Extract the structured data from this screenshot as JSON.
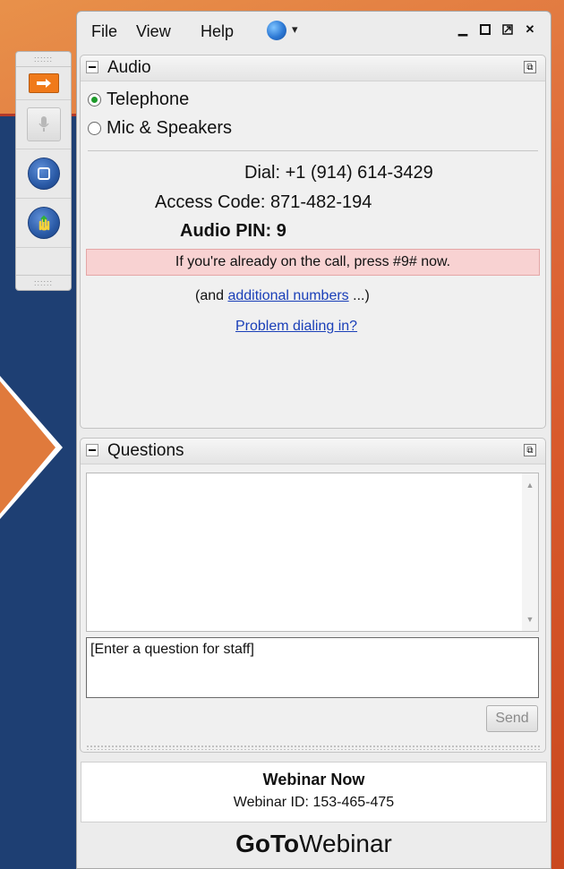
{
  "menu": {
    "file": "File",
    "view": "View",
    "help": "Help"
  },
  "audio": {
    "title": "Audio",
    "telephone_label": "Telephone",
    "mic_label": "Mic & Speakers",
    "selected": "Telephone",
    "dial_label": "Dial:",
    "dial_number": "+1 (914) 614-3429",
    "access_label": "Access Code:",
    "access_code": "871-482-194",
    "pin_label": "Audio PIN:",
    "pin_value": "9",
    "alert_text": "If you're already on the call, press #9# now.",
    "additional_prefix": "(and",
    "additional_link": "additional numbers",
    "additional_suffix": "...)",
    "problem_link": "Problem dialing in?"
  },
  "questions": {
    "title": "Questions",
    "input_placeholder": "[Enter a question for staff]",
    "send_label": "Send"
  },
  "webinar": {
    "name": "Webinar Now",
    "id_label": "Webinar ID:",
    "id_value": "153-465-475"
  },
  "brand": {
    "bold": "GoTo",
    "light": "Webinar"
  },
  "colors": {
    "accent_orange": "#f07a1a",
    "navy": "#1e3f73",
    "alert_bg": "#f8d2d2",
    "link": "#1a3fb8",
    "radio_selected": "#1d9a2a"
  }
}
